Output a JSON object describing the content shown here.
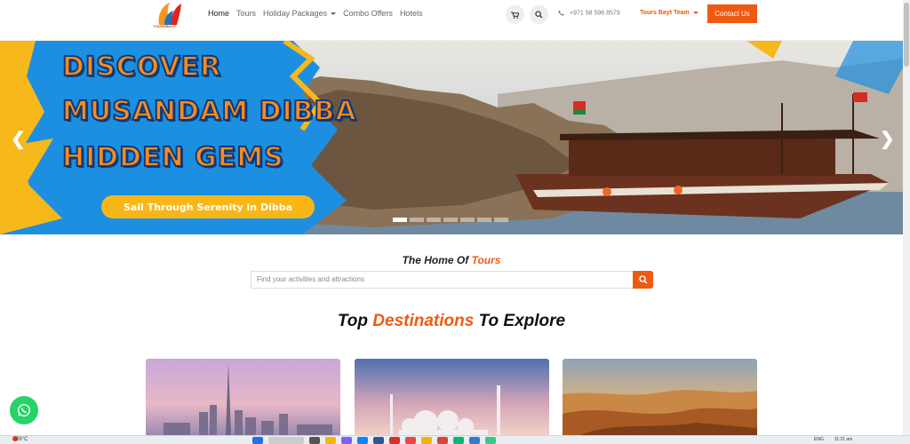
{
  "nav": {
    "logo_text": "TOURSBAYT",
    "menu": [
      {
        "label": "Home",
        "active": true,
        "dropdown": false
      },
      {
        "label": "Tours",
        "active": false,
        "dropdown": false
      },
      {
        "label": "Holiday Packages",
        "active": false,
        "dropdown": true
      },
      {
        "label": "Combo Offers",
        "active": false,
        "dropdown": false
      },
      {
        "label": "Hotels",
        "active": false,
        "dropdown": false
      }
    ],
    "cart_icon": "cart-icon",
    "search_icon": "search-icon",
    "phone": "+971 58 596 8579",
    "team_label": "Tours Bayt Team",
    "contact_label": "Contact Us"
  },
  "hero": {
    "title_lines": [
      "DISCOVER",
      "MUSANDAM DIBBA",
      "HIDDEN GEMS"
    ],
    "tagline": "Sail Through Serenity in Dibba",
    "slide_count": 7,
    "active_slide": 1
  },
  "search": {
    "heading_prefix": "The Home Of ",
    "heading_highlight": "Tours",
    "placeholder": "Find your activities and attractions"
  },
  "destinations": {
    "heading_prefix": "Top ",
    "heading_highlight": "Destinations",
    "heading_suffix": " To Explore"
  },
  "taskbar": {
    "temperature": "26°C",
    "language": "ENG",
    "time": "11:21 am"
  },
  "colors": {
    "accent": "#ef5a12",
    "whatsapp": "#25d366"
  }
}
